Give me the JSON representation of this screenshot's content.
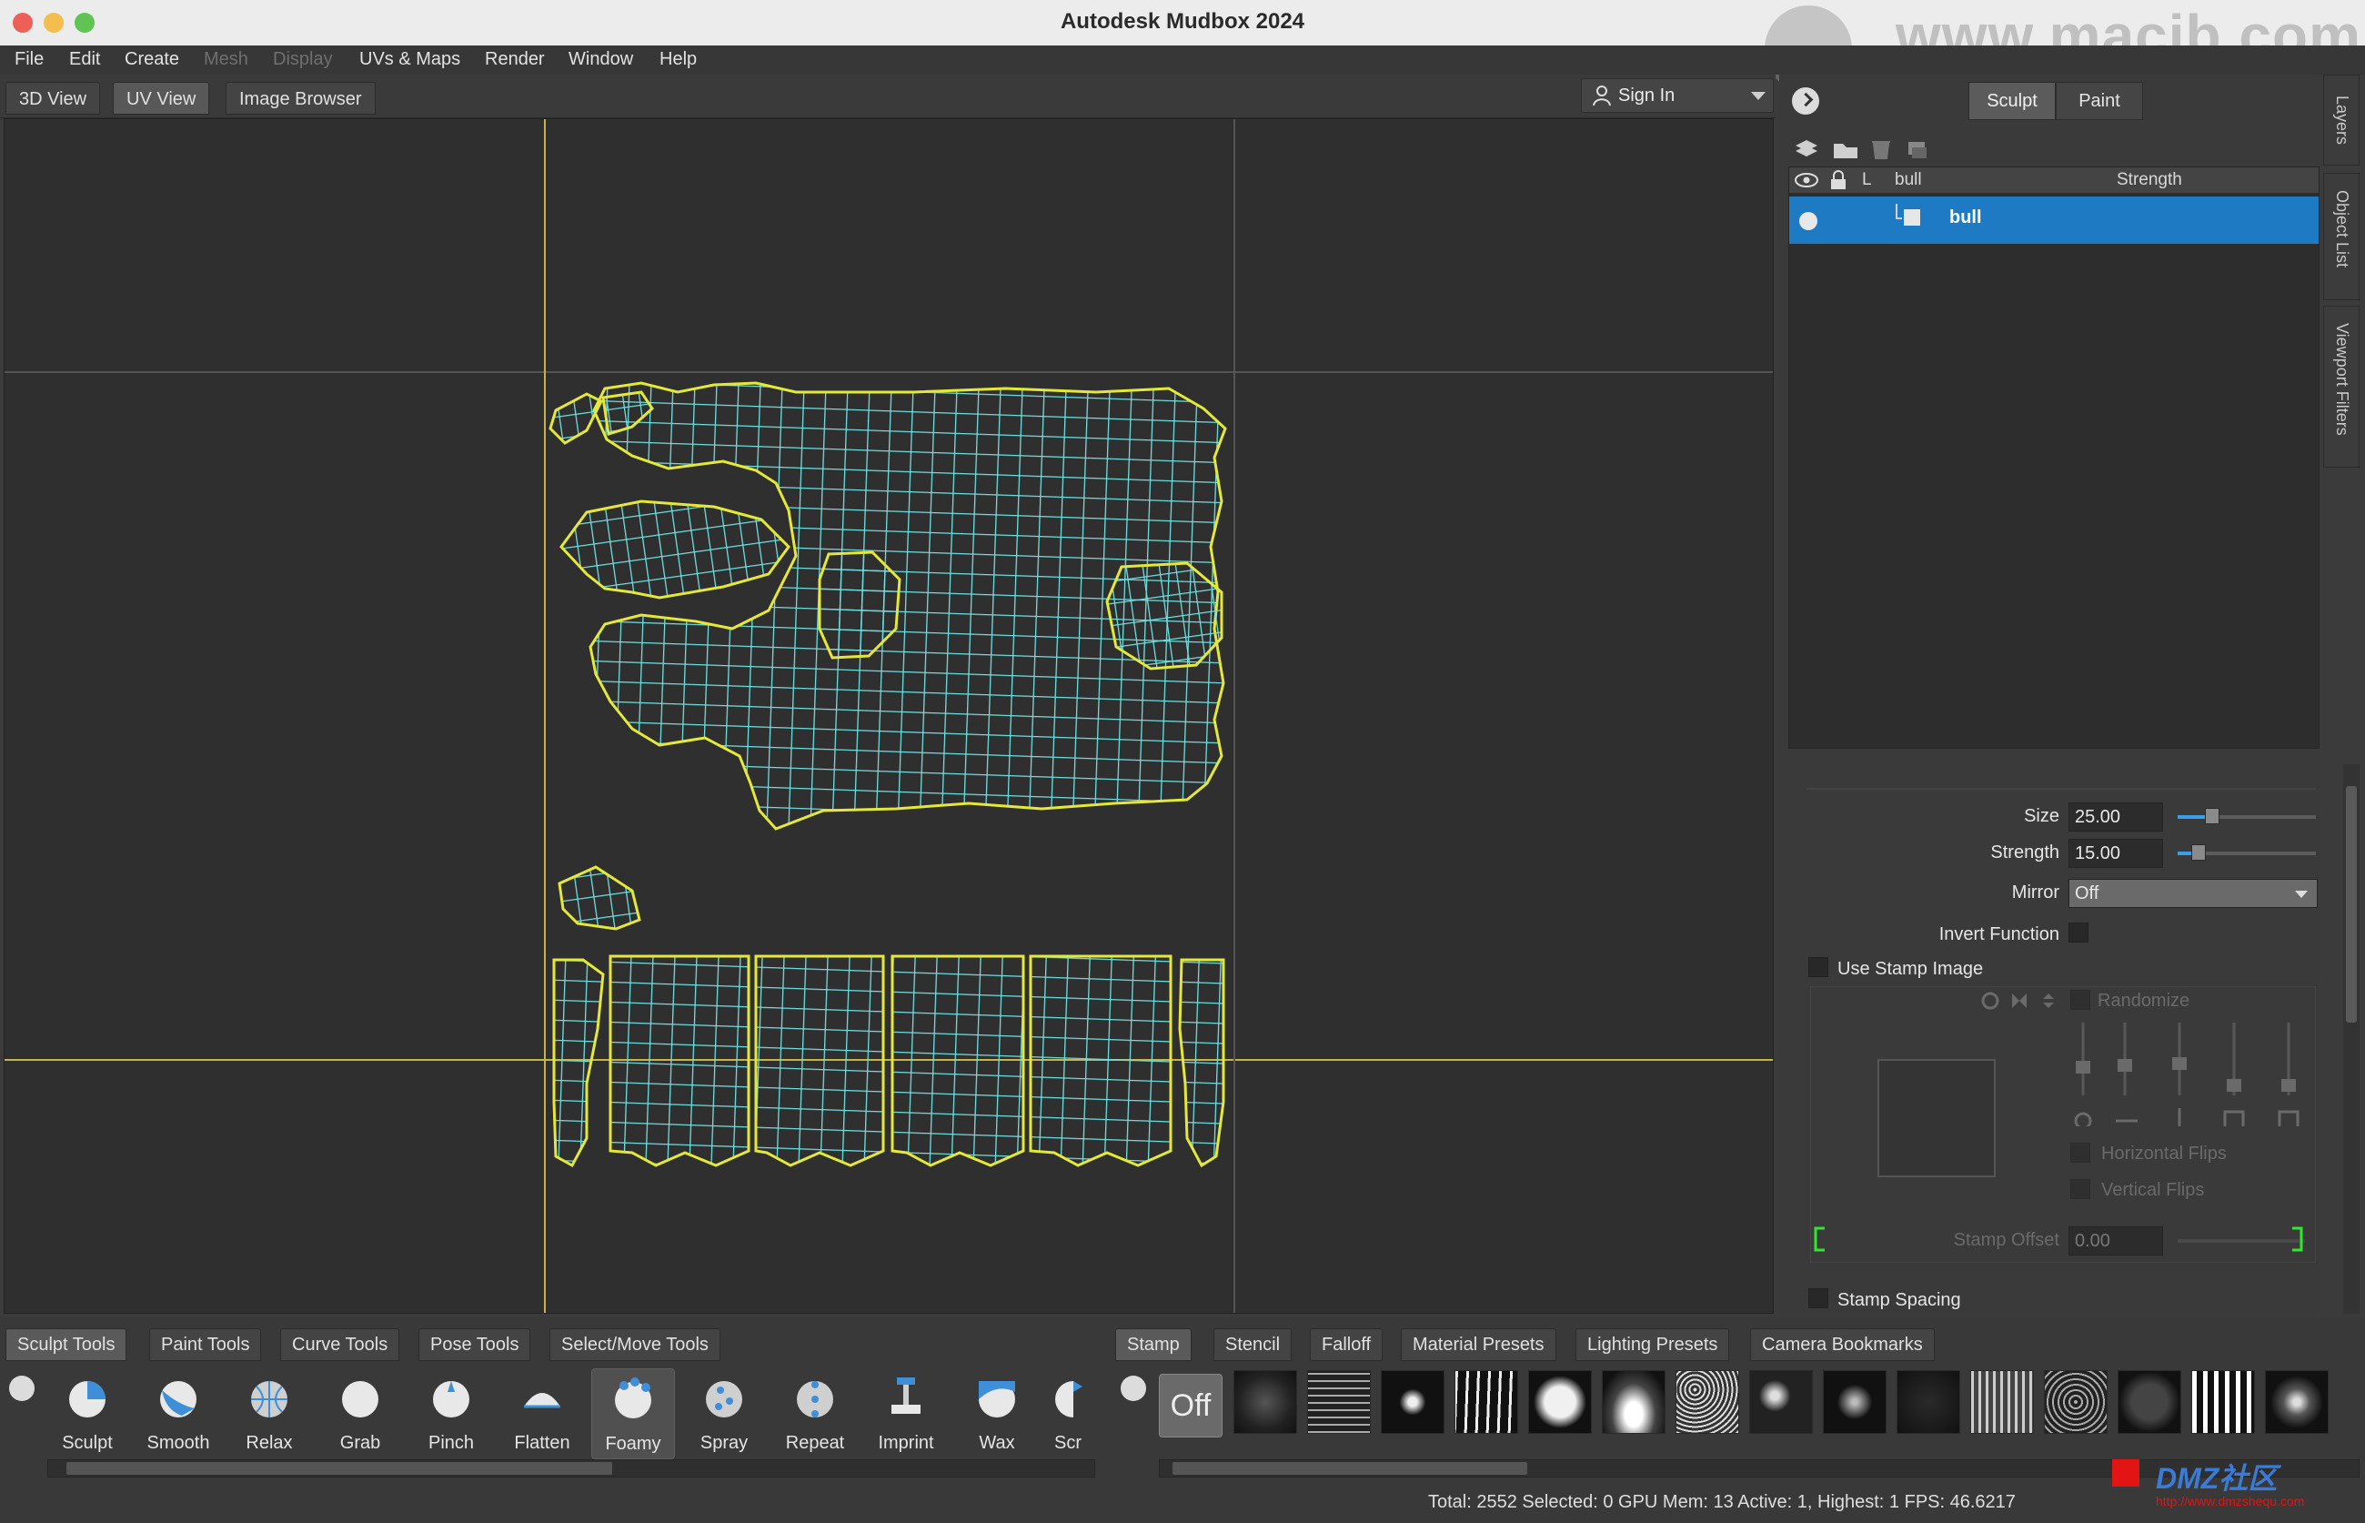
{
  "window": {
    "title": "Autodesk Mudbox 2024",
    "watermark": "www.macjb.com"
  },
  "menu": [
    "File",
    "Edit",
    "Create",
    "Mesh",
    "Display",
    "UVs & Maps",
    "Render",
    "Window",
    "Help"
  ],
  "menu_disabled": [
    "Mesh",
    "Display"
  ],
  "view_tabs": [
    "3D View",
    "UV View",
    "Image Browser"
  ],
  "active_view_tab": "UV View",
  "sign_in": "Sign In",
  "right_panel": {
    "mode_buttons": [
      "Sculpt",
      "Paint"
    ],
    "active_mode": "Sculpt",
    "layers_header": {
      "lock": "L",
      "name": "bull",
      "strength": "Strength"
    },
    "layer_row": {
      "name": "bull"
    },
    "side_tabs": [
      "Layers",
      "Object List",
      "Viewport Filters"
    ],
    "properties": {
      "size_label": "Size",
      "size_value": "25.00",
      "size_level": 0.25,
      "strength_label": "Strength",
      "strength_value": "15.00",
      "strength_level": 0.15,
      "mirror_label": "Mirror",
      "mirror_value": "Off",
      "invert_label": "Invert Function",
      "use_stamp_label": "Use Stamp Image",
      "randomize_label": "Randomize",
      "hflips_label": "Horizontal Flips",
      "vflips_label": "Vertical Flips",
      "stamp_offset_label": "Stamp Offset",
      "stamp_offset_value": "0.00",
      "stamp_spacing_label": "Stamp Spacing"
    }
  },
  "tool_tabs": [
    "Sculpt Tools",
    "Paint Tools",
    "Curve Tools",
    "Pose Tools",
    "Select/Move Tools"
  ],
  "active_tool_tab": "Sculpt Tools",
  "tools": [
    "Sculpt",
    "Smooth",
    "Relax",
    "Grab",
    "Pinch",
    "Flatten",
    "Foamy",
    "Spray",
    "Repeat",
    "Imprint",
    "Wax",
    "Scr"
  ],
  "active_tool": "Foamy",
  "stamp_tabs": [
    "Stamp",
    "Stencil",
    "Falloff",
    "Material Presets",
    "Lighting Presets",
    "Camera Bookmarks"
  ],
  "active_stamp_tab": "Stamp",
  "stamp_off_label": "Off",
  "status": "Total: 2552  Selected: 0 GPU Mem: 13  Active: 1, Highest: 1  FPS: 46.6217",
  "corner_logo": {
    "text": "DMZ社区",
    "url": "http://www.dmzshequ.com"
  },
  "colors": {
    "uv_outline": "#e3e83a",
    "uv_wire": "#6fe0e0",
    "selection": "#1f7ac4",
    "grid_line": "#c8b24a"
  }
}
